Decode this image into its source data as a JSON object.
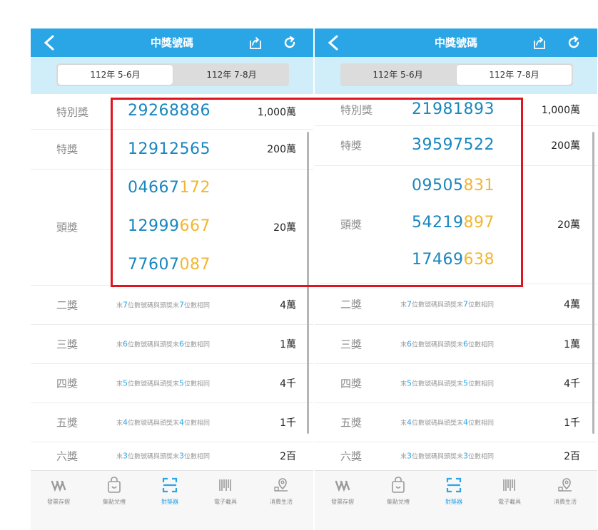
{
  "panels": [
    {
      "title": "中獎號碼",
      "segments": [
        "112年 5-6月",
        "112年 7-8月"
      ],
      "active_segment": 0,
      "special": {
        "label": "特別獎",
        "number": "29268886",
        "amount": "1,000萬"
      },
      "grand": {
        "label": "特獎",
        "number": "12912565",
        "amount": "200萬"
      },
      "first": {
        "label": "頭獎",
        "amount": "20萬",
        "numbers": [
          {
            "prefix": "04667",
            "suffix": "172"
          },
          {
            "prefix": "12999",
            "suffix": "667"
          },
          {
            "prefix": "77607",
            "suffix": "087"
          }
        ]
      },
      "prizes": [
        {
          "label": "二獎",
          "desc_a": "末",
          "digit": "7",
          "desc_b": "位數號碼與頭獎末",
          "digit2": "7",
          "desc_c": "位數相同",
          "amount": "4萬"
        },
        {
          "label": "三獎",
          "desc_a": "末",
          "digit": "6",
          "desc_b": "位數號碼與頭獎末",
          "digit2": "6",
          "desc_c": "位數相同",
          "amount": "1萬"
        },
        {
          "label": "四獎",
          "desc_a": "末",
          "digit": "5",
          "desc_b": "位數號碼與頭獎末",
          "digit2": "5",
          "desc_c": "位數相同",
          "amount": "4千"
        },
        {
          "label": "五獎",
          "desc_a": "末",
          "digit": "4",
          "desc_b": "位數號碼與頭獎末",
          "digit2": "4",
          "desc_c": "位數相同",
          "amount": "1千"
        },
        {
          "label": "六獎",
          "desc_a": "末",
          "digit": "3",
          "desc_b": "位數號碼與頭獎末",
          "digit2": "3",
          "desc_c": "位數相同",
          "amount": "2百"
        }
      ],
      "tabs": [
        "發票存摺",
        "集點兌禮",
        "對獎器",
        "電子載具",
        "消費生活"
      ],
      "active_tab": 2
    },
    {
      "title": "中獎號碼",
      "segments": [
        "112年 5-6月",
        "112年 7-8月"
      ],
      "active_segment": 1,
      "special": {
        "label": "特別獎",
        "number": "21981893",
        "amount": "1,000萬"
      },
      "grand": {
        "label": "特獎",
        "number": "39597522",
        "amount": "200萬"
      },
      "first": {
        "label": "頭獎",
        "amount": "20萬",
        "numbers": [
          {
            "prefix": "09505",
            "suffix": "831"
          },
          {
            "prefix": "54219",
            "suffix": "897"
          },
          {
            "prefix": "17469",
            "suffix": "638"
          }
        ]
      },
      "prizes": [
        {
          "label": "二獎",
          "desc_a": "末",
          "digit": "7",
          "desc_b": "位數號碼與頭獎末",
          "digit2": "7",
          "desc_c": "位數相同",
          "amount": "4萬"
        },
        {
          "label": "三獎",
          "desc_a": "末",
          "digit": "6",
          "desc_b": "位數號碼與頭獎末",
          "digit2": "6",
          "desc_c": "位數相同",
          "amount": "1萬"
        },
        {
          "label": "四獎",
          "desc_a": "末",
          "digit": "5",
          "desc_b": "位數號碼與頭獎末",
          "digit2": "5",
          "desc_c": "位數相同",
          "amount": "4千"
        },
        {
          "label": "五獎",
          "desc_a": "末",
          "digit": "4",
          "desc_b": "位數號碼與頭獎末",
          "digit2": "4",
          "desc_c": "位數相同",
          "amount": "1千"
        },
        {
          "label": "六獎",
          "desc_a": "末",
          "digit": "3",
          "desc_b": "位數號碼與頭獎末",
          "digit2": "3",
          "desc_c": "位數相同",
          "amount": "2百"
        }
      ],
      "tabs": [
        "發票存摺",
        "集點兌禮",
        "對獎器",
        "電子載具",
        "消費生活"
      ],
      "active_tab": 2
    }
  ],
  "colors": {
    "header": "#2aa6e6",
    "number_primary": "#1a86bf",
    "number_suffix": "#f2b631",
    "highlight": "#e0141e"
  }
}
